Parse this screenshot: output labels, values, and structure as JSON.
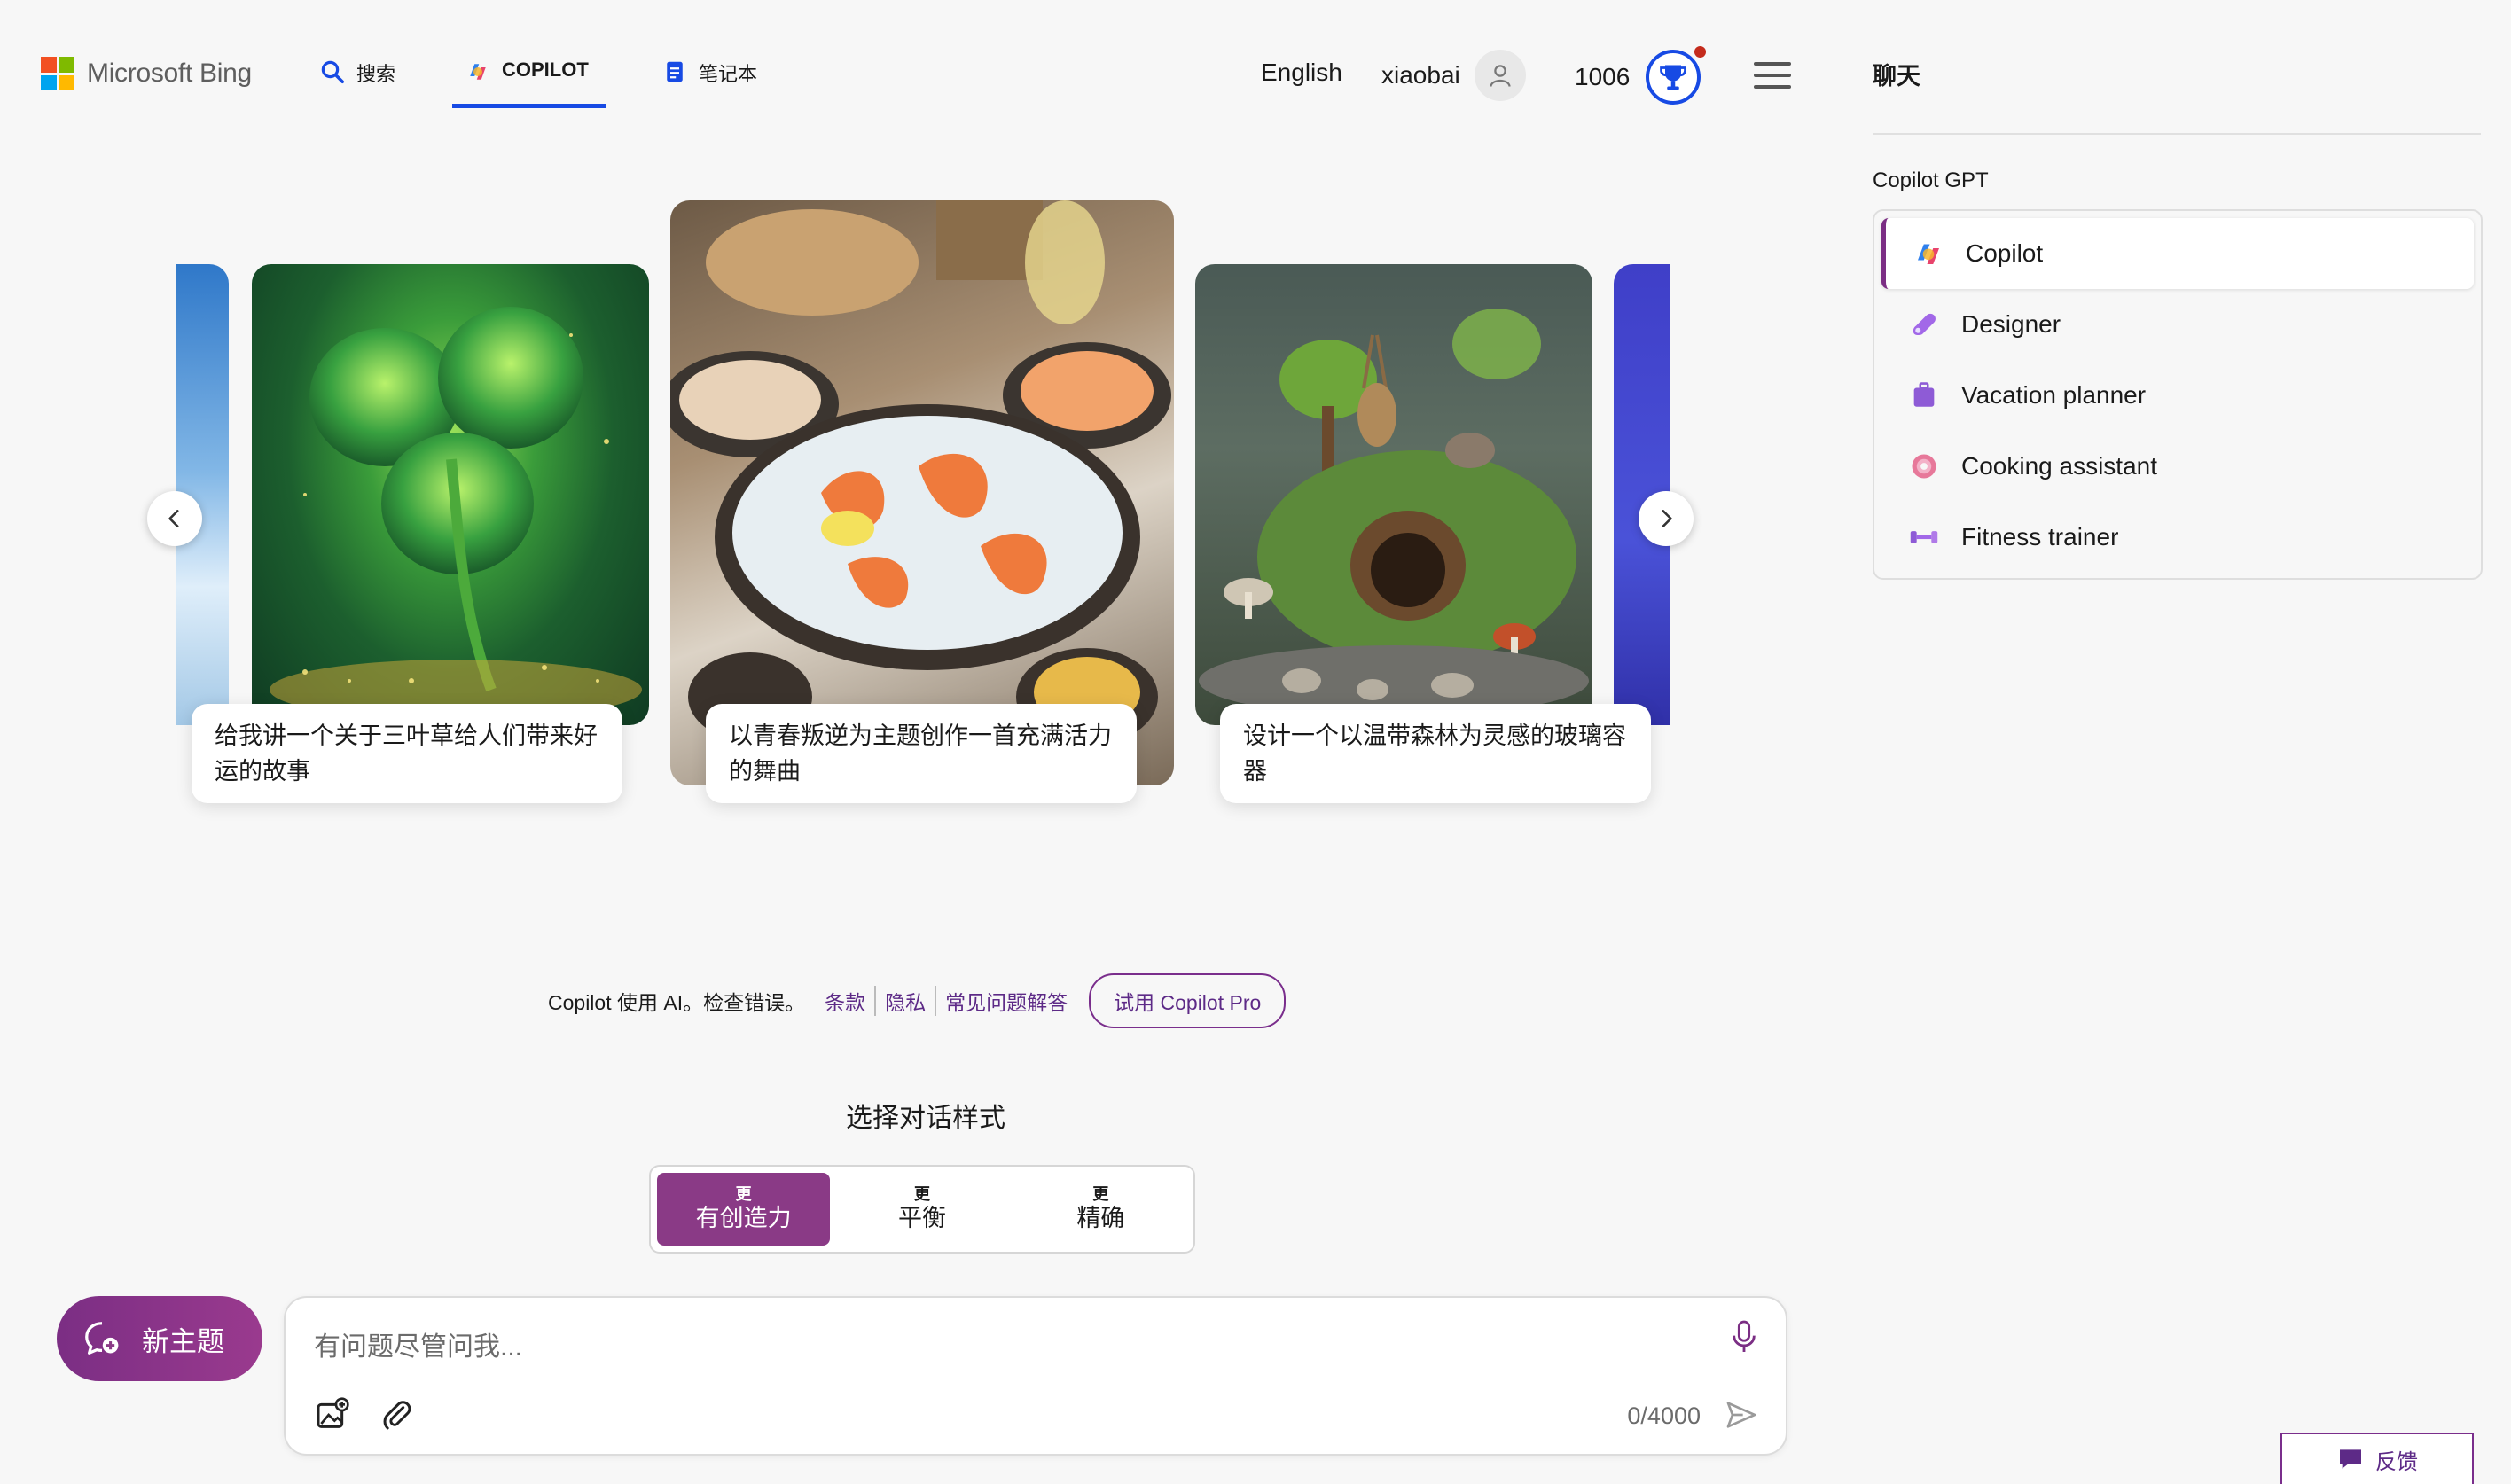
{
  "header": {
    "brand": "Microsoft Bing",
    "tabs": [
      {
        "label": "搜索"
      },
      {
        "label": "COPILOT"
      },
      {
        "label": "笔记本"
      }
    ],
    "language": "English",
    "username": "xiaobai",
    "points": "1006"
  },
  "carousel": {
    "cards": [
      {
        "caption": "给我讲一个关于三叶草给人们带来好运的故事",
        "image": "green-clover"
      },
      {
        "caption": "以青春叛逆为主题创作一首充满活力的舞曲",
        "image": "seafood-platter"
      },
      {
        "caption": "设计一个以温带森林为灵感的玻璃容器",
        "image": "forest-terrarium"
      }
    ]
  },
  "disclaimer": {
    "text": "Copilot 使用 AI。检查错误。",
    "links": [
      "条款",
      "隐私",
      "常见问题解答"
    ],
    "pro_button": "试用 Copilot Pro"
  },
  "tone": {
    "title": "选择对话样式",
    "options": [
      {
        "small": "更",
        "big": "有创造力",
        "selected": true
      },
      {
        "small": "更",
        "big": "平衡",
        "selected": false
      },
      {
        "small": "更",
        "big": "精确",
        "selected": false
      }
    ],
    "accent": "#8a3a86"
  },
  "composer": {
    "new_topic": "新主题",
    "placeholder": "有问题尽管问我...",
    "count": "0/4000"
  },
  "sidebar": {
    "title": "聊天",
    "gpt_label": "Copilot GPT",
    "items": [
      {
        "label": "Copilot",
        "icon": "copilot-icon"
      },
      {
        "label": "Designer",
        "icon": "designer-icon"
      },
      {
        "label": "Vacation planner",
        "icon": "suitcase-icon"
      },
      {
        "label": "Cooking assistant",
        "icon": "donut-icon"
      },
      {
        "label": "Fitness trainer",
        "icon": "dumbbell-icon"
      }
    ]
  },
  "feedback": "反馈",
  "colors": {
    "brand_blue": "#174ae4",
    "purple": "#7b2e84"
  }
}
